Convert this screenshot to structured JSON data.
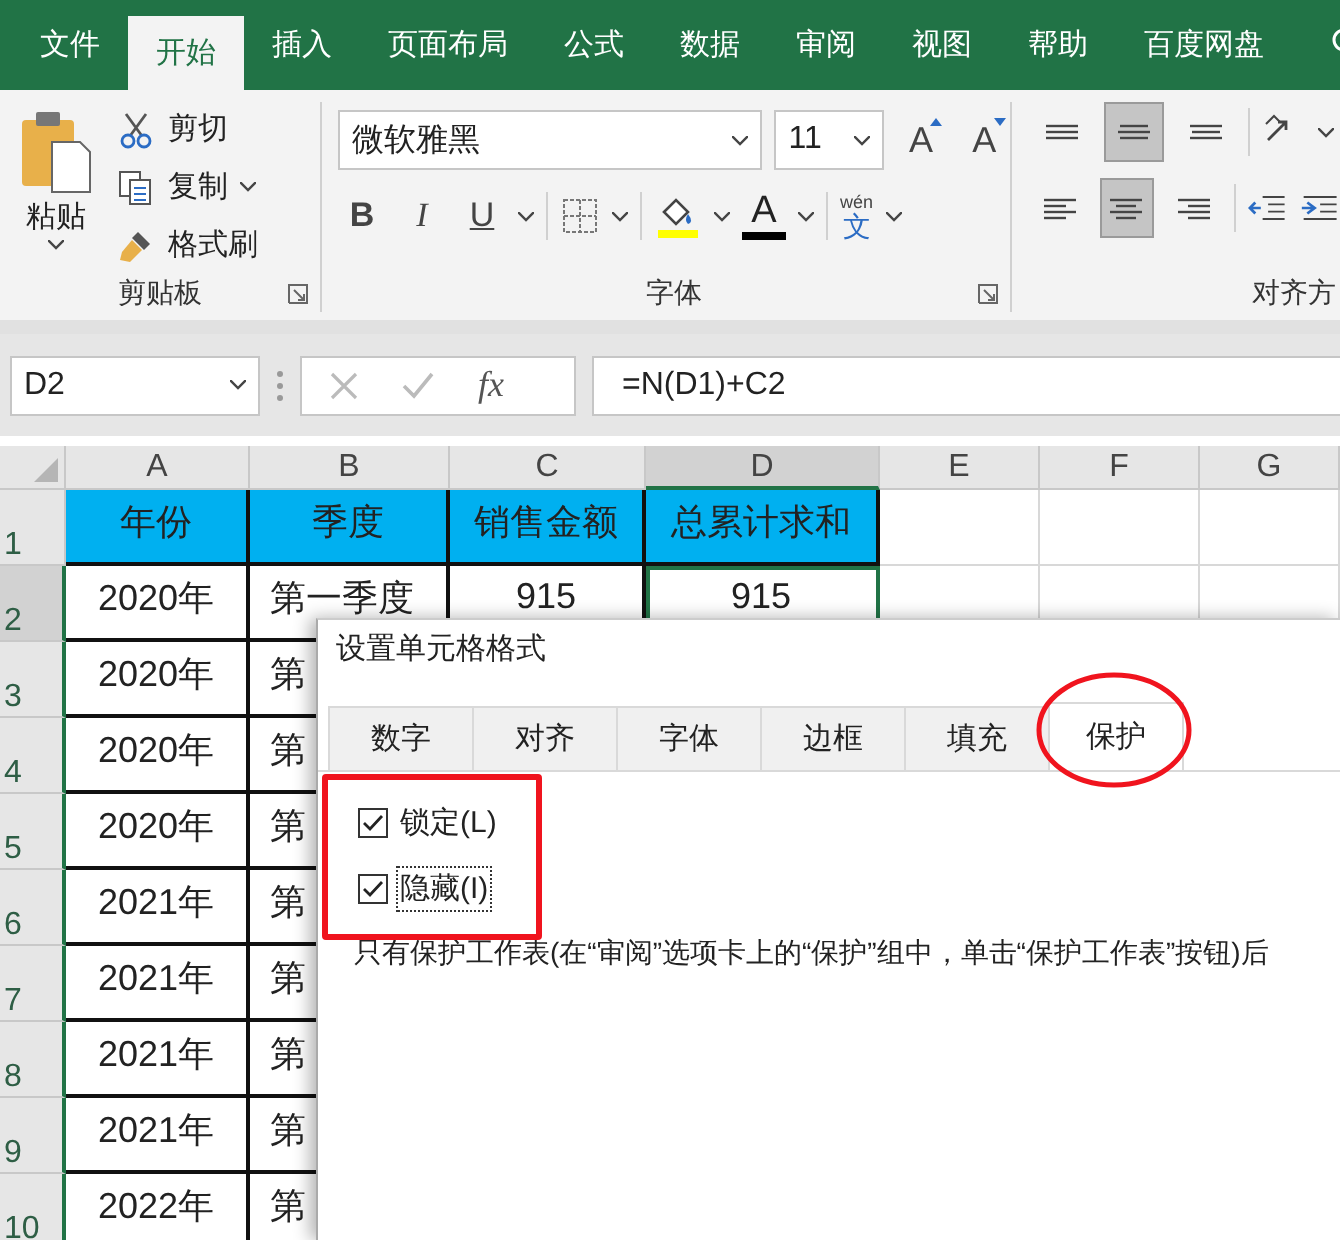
{
  "menu_tabs": [
    {
      "label": "文件",
      "selected": false
    },
    {
      "label": "开始",
      "selected": true
    },
    {
      "label": "插入",
      "selected": false
    },
    {
      "label": "页面布局",
      "selected": false
    },
    {
      "label": "公式",
      "selected": false
    },
    {
      "label": "数据",
      "selected": false
    },
    {
      "label": "审阅",
      "selected": false
    },
    {
      "label": "视图",
      "selected": false
    },
    {
      "label": "帮助",
      "selected": false
    },
    {
      "label": "百度网盘",
      "selected": false
    }
  ],
  "ribbon": {
    "clipboard": {
      "paste": "粘贴",
      "items": [
        {
          "label": "剪切",
          "kind": "cut",
          "dropdown": false
        },
        {
          "label": "复制",
          "kind": "copy",
          "dropdown": true
        },
        {
          "label": "格式刷",
          "kind": "brush",
          "dropdown": false
        }
      ],
      "label": "剪贴板"
    },
    "font": {
      "font_name": "微软雅黑",
      "font_size": "11",
      "grow": "A",
      "shrink": "A",
      "styles": [
        {
          "label": "B",
          "kind": "bold"
        },
        {
          "label": "I",
          "kind": "italic"
        },
        {
          "label": "U",
          "kind": "underline"
        }
      ],
      "font_color": "A",
      "phonetic": {
        "top": "wén",
        "bottom": "文"
      },
      "label": "字体"
    },
    "alignment": {
      "top_row": [
        {
          "kind": "top",
          "selected": false
        },
        {
          "kind": "middle",
          "selected": true
        },
        {
          "kind": "bottom",
          "selected": false
        }
      ],
      "bottom_row": [
        {
          "kind": "left",
          "selected": false
        },
        {
          "kind": "center",
          "selected": true
        },
        {
          "kind": "right",
          "selected": false
        }
      ],
      "label": "对齐方"
    }
  },
  "formula_bar": {
    "name_box": "D2",
    "fx": "fx",
    "formula": "=N(D1)+C2"
  },
  "sheet": {
    "columns": [
      {
        "label": "A",
        "selected": false
      },
      {
        "label": "B",
        "selected": false
      },
      {
        "label": "C",
        "selected": false
      },
      {
        "label": "D",
        "selected": true
      },
      {
        "label": "E",
        "selected": false
      },
      {
        "label": "F",
        "selected": false
      },
      {
        "label": "G",
        "selected": false
      }
    ],
    "rows": [
      {
        "number": "1",
        "kind": "header",
        "selected": false,
        "cells": [
          {
            "text": "年份",
            "active": false
          },
          {
            "text": "季度",
            "active": false
          },
          {
            "text": "销售金额",
            "active": false
          },
          {
            "text": "总累计求和",
            "active": false
          }
        ]
      },
      {
        "number": "2",
        "kind": "data",
        "selected": true,
        "cells": [
          {
            "text": "2020年",
            "active": false
          },
          {
            "text": "第一季度",
            "active": false
          },
          {
            "text": "915",
            "active": false
          },
          {
            "text": "915",
            "active": true
          }
        ]
      },
      {
        "number": "3",
        "kind": "data",
        "selected": false,
        "cells": [
          {
            "text": "2020年",
            "active": false
          },
          {
            "text": "第",
            "active": false
          }
        ]
      },
      {
        "number": "4",
        "kind": "data",
        "selected": false,
        "cells": [
          {
            "text": "2020年",
            "active": false
          },
          {
            "text": "第",
            "active": false
          }
        ]
      },
      {
        "number": "5",
        "kind": "data",
        "selected": false,
        "cells": [
          {
            "text": "2020年",
            "active": false
          },
          {
            "text": "第",
            "active": false
          }
        ]
      },
      {
        "number": "6",
        "kind": "data",
        "selected": false,
        "cells": [
          {
            "text": "2021年",
            "active": false
          },
          {
            "text": "第",
            "active": false
          }
        ]
      },
      {
        "number": "7",
        "kind": "data",
        "selected": false,
        "cells": [
          {
            "text": "2021年",
            "active": false
          },
          {
            "text": "第",
            "active": false
          }
        ]
      },
      {
        "number": "8",
        "kind": "data",
        "selected": false,
        "cells": [
          {
            "text": "2021年",
            "active": false
          },
          {
            "text": "第",
            "active": false
          }
        ]
      },
      {
        "number": "9",
        "kind": "data",
        "selected": false,
        "cells": [
          {
            "text": "2021年",
            "active": false
          },
          {
            "text": "第",
            "active": false
          }
        ]
      },
      {
        "number": "10",
        "kind": "data",
        "selected": false,
        "cells": [
          {
            "text": "2022年",
            "active": false
          },
          {
            "text": "第",
            "active": false
          }
        ]
      }
    ]
  },
  "dialog": {
    "title": "设置单元格格式",
    "tabs": [
      {
        "label": "数字",
        "selected": false,
        "circled": false
      },
      {
        "label": "对齐",
        "selected": false,
        "circled": false
      },
      {
        "label": "字体",
        "selected": false,
        "circled": false
      },
      {
        "label": "边框",
        "selected": false,
        "circled": false
      },
      {
        "label": "填充",
        "selected": false,
        "circled": false
      },
      {
        "label": "保护",
        "selected": true,
        "circled": true
      }
    ],
    "options_boxed": true,
    "options": [
      {
        "label": "锁定(L)",
        "checked": true,
        "focused": false
      },
      {
        "label": "隐藏(I)",
        "checked": true,
        "focused": true
      }
    ],
    "note": "只有保护工作表(在“审阅”选项卡上的“保护”组中，单击“保护工作表”按钮)后"
  }
}
